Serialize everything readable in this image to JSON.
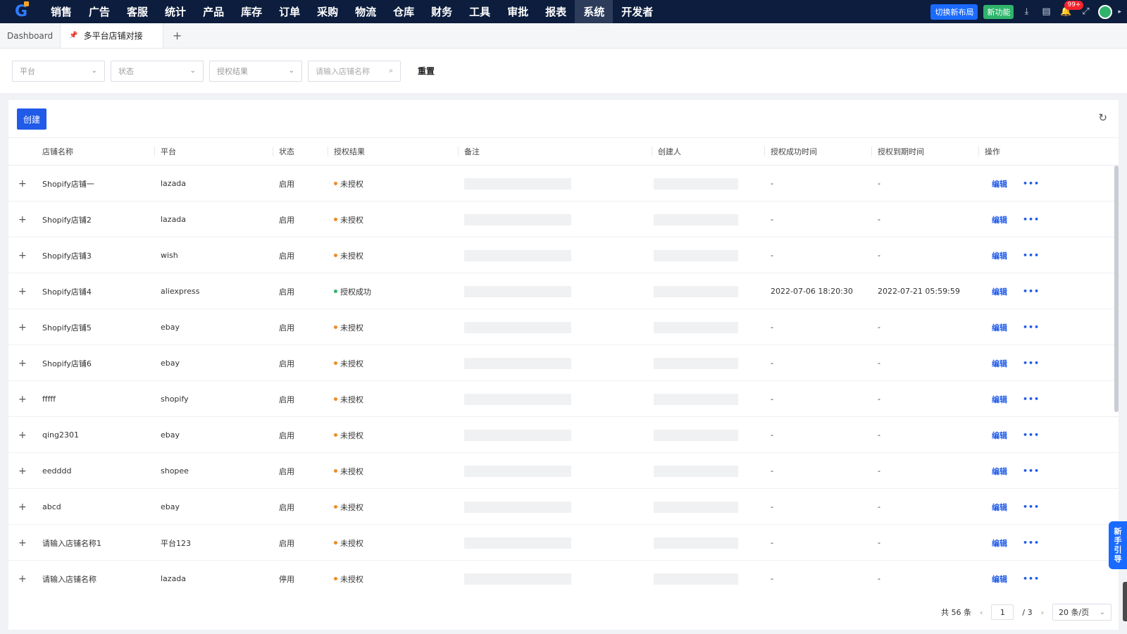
{
  "nav": {
    "logo": "G",
    "items": [
      "销售",
      "广告",
      "客服",
      "统计",
      "产品",
      "库存",
      "订单",
      "采购",
      "物流",
      "仓库",
      "财务",
      "工具",
      "审批",
      "报表",
      "系统",
      "开发者"
    ],
    "active_index": 14,
    "layout_button": "切换新布局",
    "new_feature": "新功能",
    "notifications_badge": "99+"
  },
  "tabs": {
    "dashboard": "Dashboard",
    "active": "多平台店铺对接",
    "add": "+"
  },
  "filters": {
    "platform": "平台",
    "status": "状态",
    "auth_result": "授权结果",
    "search_placeholder": "请输入店铺名称",
    "reset": "重置"
  },
  "toolbar": {
    "create": "创建"
  },
  "table": {
    "columns": [
      "店铺名称",
      "平台",
      "状态",
      "授权结果",
      "备注",
      "创建人",
      "授权成功时间",
      "授权到期时间",
      "操作"
    ],
    "edit_label": "编辑",
    "rows": [
      {
        "name": "Shopify店铺一",
        "platform": "lazada",
        "status": "启用",
        "auth": "未授权",
        "auth_color": "#f08a24",
        "success_time": "-",
        "expire_time": "-"
      },
      {
        "name": "Shopify店铺2",
        "platform": "lazada",
        "status": "启用",
        "auth": "未授权",
        "auth_color": "#f08a24",
        "success_time": "-",
        "expire_time": "-"
      },
      {
        "name": "Shopify店铺3",
        "platform": "wish",
        "status": "启用",
        "auth": "未授权",
        "auth_color": "#f08a24",
        "success_time": "-",
        "expire_time": "-"
      },
      {
        "name": "Shopify店铺4",
        "platform": "aliexpress",
        "status": "启用",
        "auth": "授权成功",
        "auth_color": "#2fb36b",
        "success_time": "2022-07-06 18:20:30",
        "expire_time": "2022-07-21 05:59:59"
      },
      {
        "name": "Shopify店铺5",
        "platform": "ebay",
        "status": "启用",
        "auth": "未授权",
        "auth_color": "#f08a24",
        "success_time": "-",
        "expire_time": "-"
      },
      {
        "name": "Shopify店铺6",
        "platform": "ebay",
        "status": "启用",
        "auth": "未授权",
        "auth_color": "#f08a24",
        "success_time": "-",
        "expire_time": "-"
      },
      {
        "name": "fffff",
        "platform": "shopify",
        "status": "启用",
        "auth": "未授权",
        "auth_color": "#f08a24",
        "success_time": "-",
        "expire_time": "-"
      },
      {
        "name": "qing2301",
        "platform": "ebay",
        "status": "启用",
        "auth": "未授权",
        "auth_color": "#f08a24",
        "success_time": "-",
        "expire_time": "-"
      },
      {
        "name": "eedddd",
        "platform": "shopee",
        "status": "启用",
        "auth": "未授权",
        "auth_color": "#f08a24",
        "success_time": "-",
        "expire_time": "-"
      },
      {
        "name": "abcd",
        "platform": "ebay",
        "status": "启用",
        "auth": "未授权",
        "auth_color": "#f08a24",
        "success_time": "-",
        "expire_time": "-"
      },
      {
        "name": "请输入店铺名称1",
        "platform": "平台123",
        "status": "启用",
        "auth": "未授权",
        "auth_color": "#f08a24",
        "success_time": "-",
        "expire_time": "-"
      },
      {
        "name": "请输入店铺名称",
        "platform": "lazada",
        "status": "停用",
        "auth": "未授权",
        "auth_color": "#f08a24",
        "success_time": "-",
        "expire_time": "-"
      }
    ]
  },
  "pagination": {
    "total": "共 56 条",
    "current": "1",
    "pages": "/ 3",
    "page_size": "20 条/页"
  },
  "guide": [
    "新",
    "手",
    "引",
    "导"
  ]
}
